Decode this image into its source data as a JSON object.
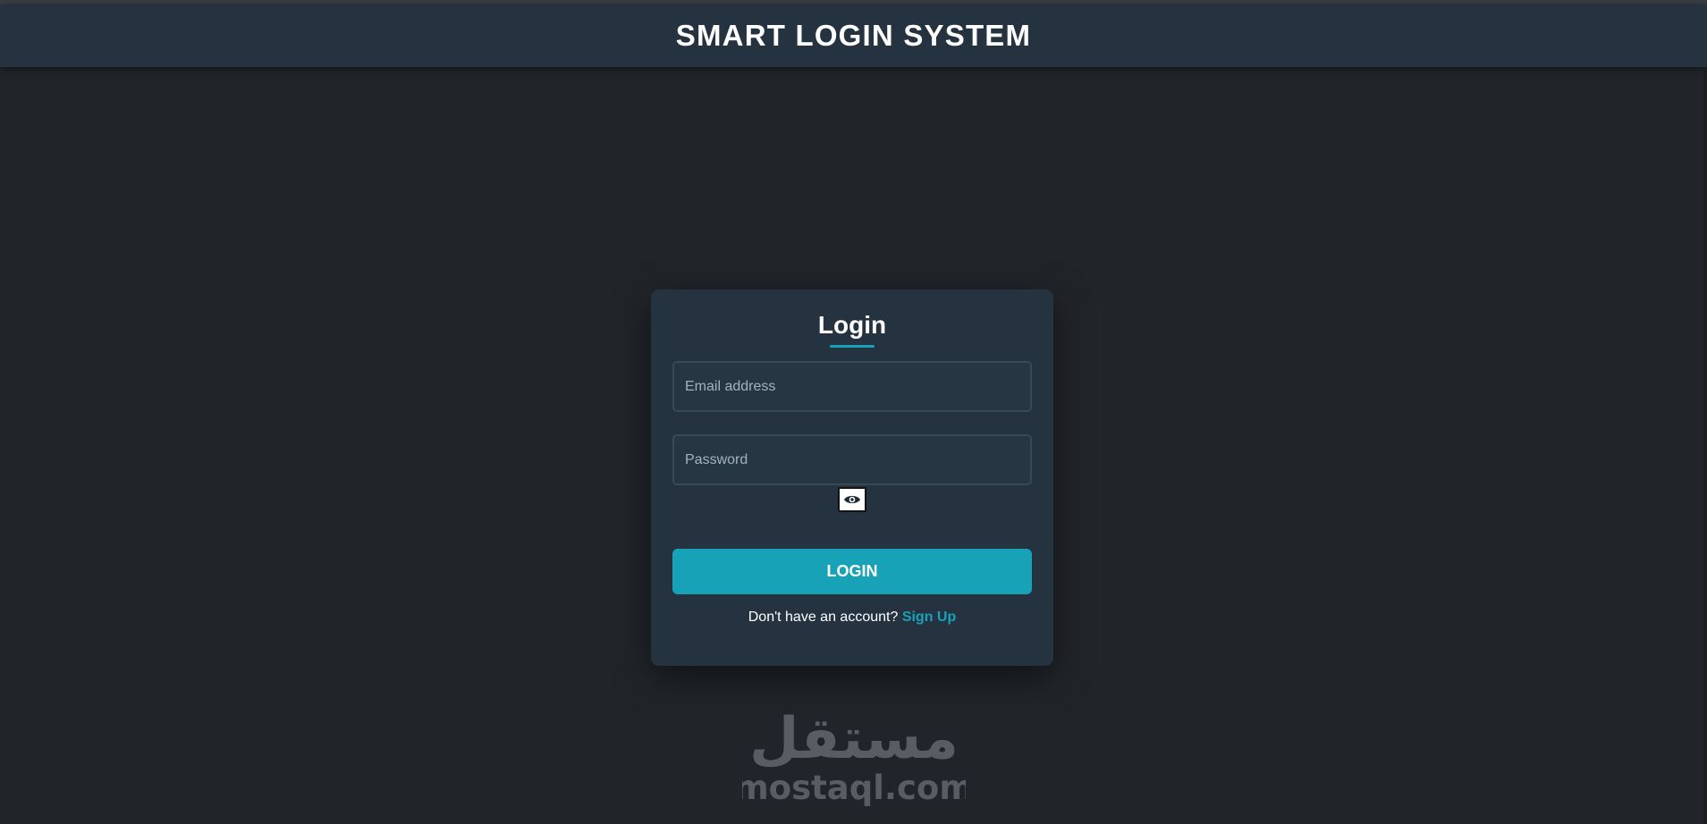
{
  "header": {
    "title": "SMART LOGIN SYSTEM"
  },
  "login_form": {
    "title": "Login",
    "email": {
      "placeholder": "Email address",
      "value": ""
    },
    "password": {
      "placeholder": "Password",
      "value": ""
    },
    "toggle_icon": "eye-icon",
    "submit_label": "LOGIN",
    "signup_prompt": "Don't have an account?",
    "signup_link": "Sign Up"
  },
  "watermark": {
    "arabic_text": "مستقل",
    "latin_text": "mostaql.com"
  },
  "colors": {
    "page_background": "#212529",
    "header_background": "#253340",
    "card_background": "#253340",
    "accent": "#17a2b8",
    "text": "#ffffff",
    "watermark": "#5c6167"
  }
}
